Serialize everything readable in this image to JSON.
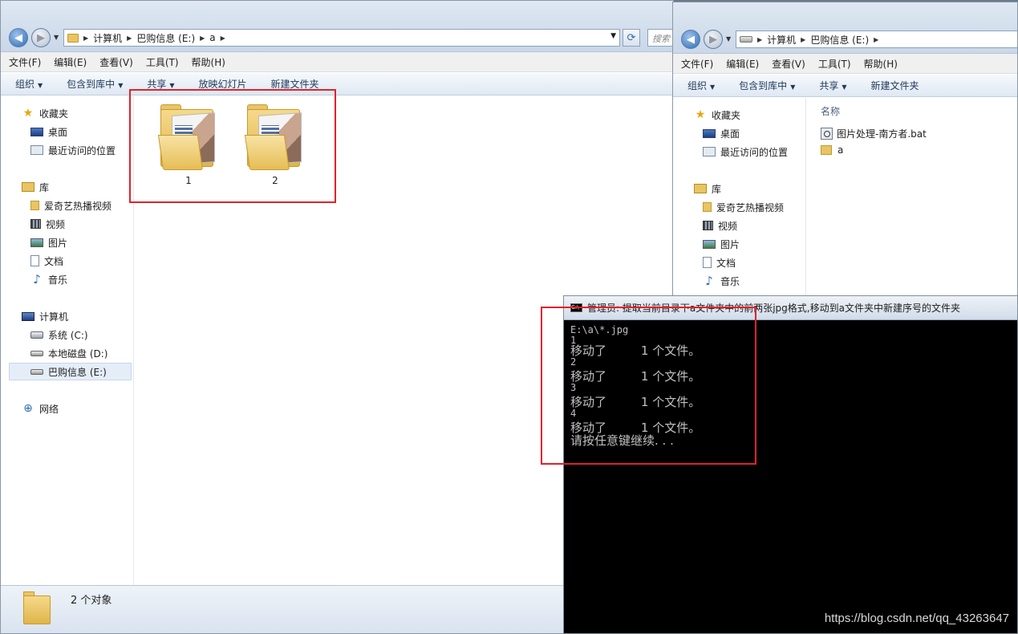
{
  "left_window": {
    "breadcrumb": [
      "计算机",
      "巴购信息 (E:)",
      "a"
    ],
    "search_placeholder": "搜索",
    "menu": [
      "文件(F)",
      "编辑(E)",
      "查看(V)",
      "工具(T)",
      "帮助(H)"
    ],
    "toolbar": [
      "组织",
      "包含到库中",
      "共享",
      "放映幻灯片",
      "新建文件夹"
    ],
    "nav": {
      "favorites": "收藏夹",
      "desktop": "桌面",
      "recent": "最近访问的位置",
      "libraries": "库",
      "iqiyi": "爱奇艺热播视频",
      "videos": "视频",
      "pictures": "图片",
      "documents": "文档",
      "music": "音乐",
      "computer": "计算机",
      "sys_drive": "系统 (C:)",
      "local_drive": "本地磁盘 (D:)",
      "e_drive": "巴购信息 (E:)",
      "network": "网络"
    },
    "folders": [
      "1",
      "2"
    ],
    "status": "2 个对象"
  },
  "right_window": {
    "breadcrumb": [
      "计算机",
      "巴购信息 (E:)"
    ],
    "menu": [
      "文件(F)",
      "编辑(E)",
      "查看(V)",
      "工具(T)",
      "帮助(H)"
    ],
    "toolbar": [
      "组织",
      "包含到库中",
      "共享",
      "新建文件夹"
    ],
    "nav": {
      "favorites": "收藏夹",
      "desktop": "桌面",
      "recent": "最近访问的位置",
      "libraries": "库",
      "iqiyi": "爱奇艺热播视频",
      "videos": "视频",
      "pictures": "图片",
      "documents": "文档",
      "music": "音乐"
    },
    "column_name": "名称",
    "files": [
      "图片处理-南方者.bat",
      "a"
    ]
  },
  "console": {
    "title": "管理员:  提取当前目录下a文件夹中的前两张jpg格式,移动到a文件夹中新建序号的文件夹",
    "lines": {
      "l0": "E:\\a\\*.jpg",
      "l1": "1",
      "l2": "移动了         1 个文件。",
      "l3": "2",
      "l4": "移动了         1 个文件。",
      "l5": "3",
      "l6": "移动了         1 个文件。",
      "l7": "4",
      "l8": "移动了         1 个文件。",
      "l9": "请按任意键继续. . ."
    }
  },
  "watermark": "https://blog.csdn.net/qq_43263647",
  "colors": {
    "highlight": "#e0222a",
    "console_bg": "#000000",
    "console_text": "#c0c0c0"
  }
}
